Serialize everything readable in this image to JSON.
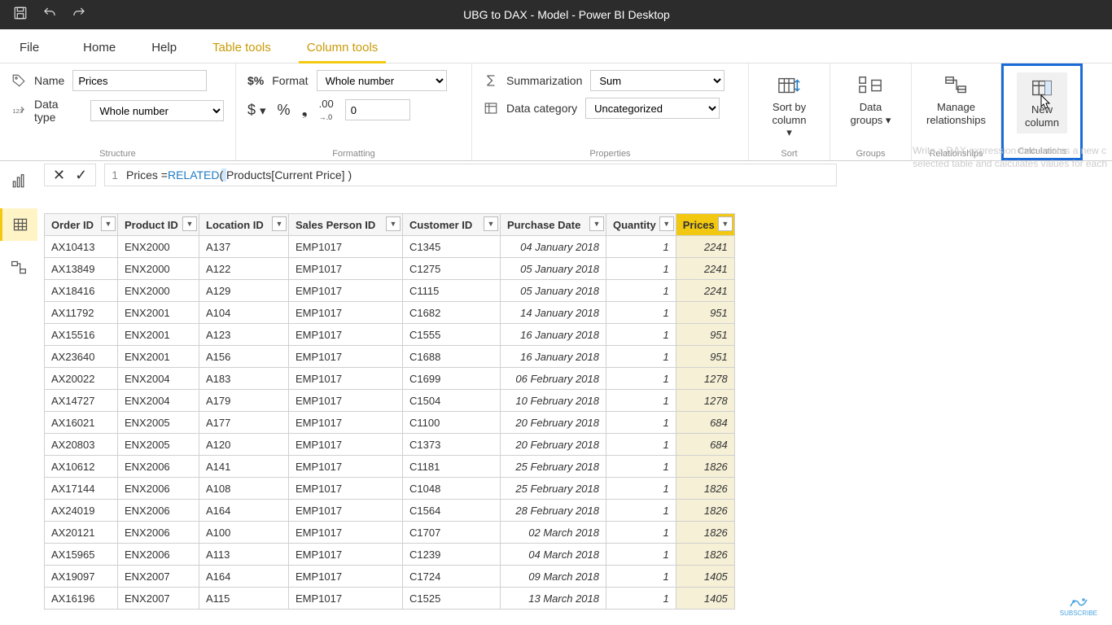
{
  "titlebar": {
    "title": "UBG to DAX - Model - Power BI Desktop"
  },
  "tabs": {
    "file": "File",
    "home": "Home",
    "help": "Help",
    "table_tools": "Table tools",
    "column_tools": "Column tools"
  },
  "structure": {
    "name_label": "Name",
    "name_value": "Prices",
    "type_label": "Data type",
    "type_value": "Whole number",
    "group_label": "Structure"
  },
  "formatting": {
    "format_label": "Format",
    "format_value": "Whole number",
    "decimals_value": "0",
    "group_label": "Formatting"
  },
  "properties": {
    "sum_label": "Summarization",
    "sum_value": "Sum",
    "cat_label": "Data category",
    "cat_value": "Uncategorized",
    "group_label": "Properties"
  },
  "sort": {
    "label1": "Sort by",
    "label2": "column",
    "group_label": "Sort"
  },
  "groups": {
    "label1": "Data",
    "label2": "groups",
    "group_label": "Groups"
  },
  "relationships": {
    "label1": "Manage",
    "label2": "relationships",
    "group_label": "Relationships"
  },
  "calculations": {
    "label1": "New",
    "label2": "column",
    "group_label": "Calculations"
  },
  "tooltip": {
    "l1": "Write a DAX expression that creates a new c",
    "l2": "selected table and calculates values for each"
  },
  "formula": {
    "line": "1",
    "prefix": "Prices = ",
    "fn": "RELATED",
    "args": "( Products[Current Price] )"
  },
  "columns": [
    "Order ID",
    "Product ID",
    "Location ID",
    "Sales Person ID",
    "Customer ID",
    "Purchase Date",
    "Quantity",
    "Prices"
  ],
  "rows": [
    [
      "AX10413",
      "ENX2000",
      "A137",
      "EMP1017",
      "C1345",
      "04 January 2018",
      "1",
      "2241"
    ],
    [
      "AX13849",
      "ENX2000",
      "A122",
      "EMP1017",
      "C1275",
      "05 January 2018",
      "1",
      "2241"
    ],
    [
      "AX18416",
      "ENX2000",
      "A129",
      "EMP1017",
      "C1115",
      "05 January 2018",
      "1",
      "2241"
    ],
    [
      "AX11792",
      "ENX2001",
      "A104",
      "EMP1017",
      "C1682",
      "14 January 2018",
      "1",
      "951"
    ],
    [
      "AX15516",
      "ENX2001",
      "A123",
      "EMP1017",
      "C1555",
      "16 January 2018",
      "1",
      "951"
    ],
    [
      "AX23640",
      "ENX2001",
      "A156",
      "EMP1017",
      "C1688",
      "16 January 2018",
      "1",
      "951"
    ],
    [
      "AX20022",
      "ENX2004",
      "A183",
      "EMP1017",
      "C1699",
      "06 February 2018",
      "1",
      "1278"
    ],
    [
      "AX14727",
      "ENX2004",
      "A179",
      "EMP1017",
      "C1504",
      "10 February 2018",
      "1",
      "1278"
    ],
    [
      "AX16021",
      "ENX2005",
      "A177",
      "EMP1017",
      "C1100",
      "20 February 2018",
      "1",
      "684"
    ],
    [
      "AX20803",
      "ENX2005",
      "A120",
      "EMP1017",
      "C1373",
      "20 February 2018",
      "1",
      "684"
    ],
    [
      "AX10612",
      "ENX2006",
      "A141",
      "EMP1017",
      "C1181",
      "25 February 2018",
      "1",
      "1826"
    ],
    [
      "AX17144",
      "ENX2006",
      "A108",
      "EMP1017",
      "C1048",
      "25 February 2018",
      "1",
      "1826"
    ],
    [
      "AX24019",
      "ENX2006",
      "A164",
      "EMP1017",
      "C1564",
      "28 February 2018",
      "1",
      "1826"
    ],
    [
      "AX20121",
      "ENX2006",
      "A100",
      "EMP1017",
      "C1707",
      "02 March 2018",
      "1",
      "1826"
    ],
    [
      "AX15965",
      "ENX2006",
      "A113",
      "EMP1017",
      "C1239",
      "04 March 2018",
      "1",
      "1826"
    ],
    [
      "AX19097",
      "ENX2007",
      "A164",
      "EMP1017",
      "C1724",
      "09 March 2018",
      "1",
      "1405"
    ],
    [
      "AX16196",
      "ENX2007",
      "A115",
      "EMP1017",
      "C1525",
      "13 March 2018",
      "1",
      "1405"
    ]
  ],
  "subscribe": "SUBSCRIBE"
}
